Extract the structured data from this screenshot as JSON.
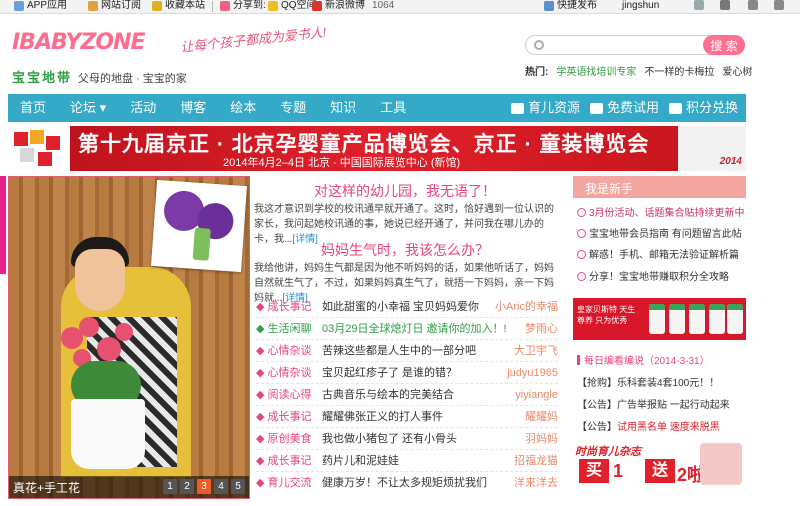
{
  "toolbar": {
    "app": "APP应用",
    "subscribe": "网站订阅",
    "bookmark": "收藏本站",
    "share": "分享到:",
    "qzone": "QQ空间",
    "weibo": "新浪微博",
    "count": "1064",
    "quickpub": "快捷发布",
    "user": "jingshun"
  },
  "header": {
    "logo": "IBABYZONE",
    "logo_cn": "宝宝地带",
    "logo_tag": "父母的地盘 · 宝宝的家",
    "slogan": "让每个孩子都成为爱书人!",
    "search_placeholder": "",
    "search_button": "搜 索",
    "hot_label": "热门:",
    "hot_links": [
      "学英语找培训专家",
      "不一样的卡梅拉",
      "爱心树"
    ]
  },
  "nav": {
    "items": [
      "首页",
      "论坛",
      "活动",
      "博客",
      "绘本",
      "专题",
      "知识",
      "工具"
    ],
    "right": [
      "育儿资源",
      "免费试用",
      "积分兑换"
    ]
  },
  "banner": {
    "title": "第十九届京正 · 北京孕婴童产品博览会、京正 · 童装博览会",
    "subtitle": "2014年4月2–4日  北京 · 中国国际展览中心 (新馆)",
    "year": "2014"
  },
  "slideshow": {
    "caption": "真花+手工花",
    "pages": [
      "1",
      "2",
      "3",
      "4",
      "5"
    ],
    "active": 3
  },
  "articles": [
    {
      "title": "对这样的幼儿园，我无语了！",
      "body": "我这才意识到学校的校讯通早就开通了。这时，恰好遇到一位认识的家长，我问起她校讯通的事，她说已经开通了，并问我在哪儿办的卡，我...",
      "more": "[详情]"
    },
    {
      "title": "妈妈生气时，我该怎么办？",
      "body": "我给他讲，妈妈生气都是因为他不听妈妈的话，如果他听话了，妈妈自然就生气了，不过，如果妈妈真生气了，就捂一下妈妈，亲一下妈妈就...",
      "more": "[详情]"
    }
  ],
  "posts": [
    {
      "cat": "成长事记",
      "title": "如此甜蜜的小幸福 宝贝妈妈爱你",
      "author": "小Aric的幸福"
    },
    {
      "cat": "生活闲聊",
      "title": "03月29日全球熄灯日 邀请你的加入！!",
      "author": "梦雨心"
    },
    {
      "cat": "心情杂谈",
      "title": "苦辣这些都是人生中的一部分吧",
      "author": "大卫宇飞"
    },
    {
      "cat": "心情杂谈",
      "title": "宝贝起红疹子了 是谁的错？",
      "author": "judyu1965"
    },
    {
      "cat": "阅读心得",
      "title": "古典音乐与绘本的完美结合",
      "author": "yiyiangle"
    },
    {
      "cat": "成长事记",
      "title": "耀耀佛张正义的打人事件",
      "author": "耀耀妈"
    },
    {
      "cat": "原创美食",
      "title": "我也做小猪包了 还有小骨头",
      "author": "羽妈妈"
    },
    {
      "cat": "成长事记",
      "title": "药片儿和泥娃娃",
      "author": "招福龙猫"
    },
    {
      "cat": "育儿交流",
      "title": "健康万岁！不让太多规矩烦扰我们",
      "author": "洋来洋去"
    }
  ],
  "newbie": {
    "title": "我是新手",
    "items": [
      "3月份活动、话题集合贴持续更新中",
      "宝宝地带会员指南 有问题留言此帖",
      "解惑！手机、邮箱无法验证解析篇",
      "分享！宝宝地带赚取积分全攻略"
    ]
  },
  "ad1": {
    "text": "皇家贝斯特 天生尊养 只为优秀"
  },
  "daily": {
    "title": "每日编看编说（2014-3-31）",
    "items": [
      {
        "tag": "【抢购】",
        "text": "乐科套装4套100元！！"
      },
      {
        "tag": "【公告】",
        "text": "广告举报贴 一起行动起来"
      },
      {
        "tag": "【公告】",
        "text": "试用黑名单 速度来脱黑"
      }
    ]
  },
  "ad2": {
    "a": "时尚育儿杂志",
    "b": "买",
    "c": "1",
    "d": "送",
    "e": "2啦!"
  }
}
